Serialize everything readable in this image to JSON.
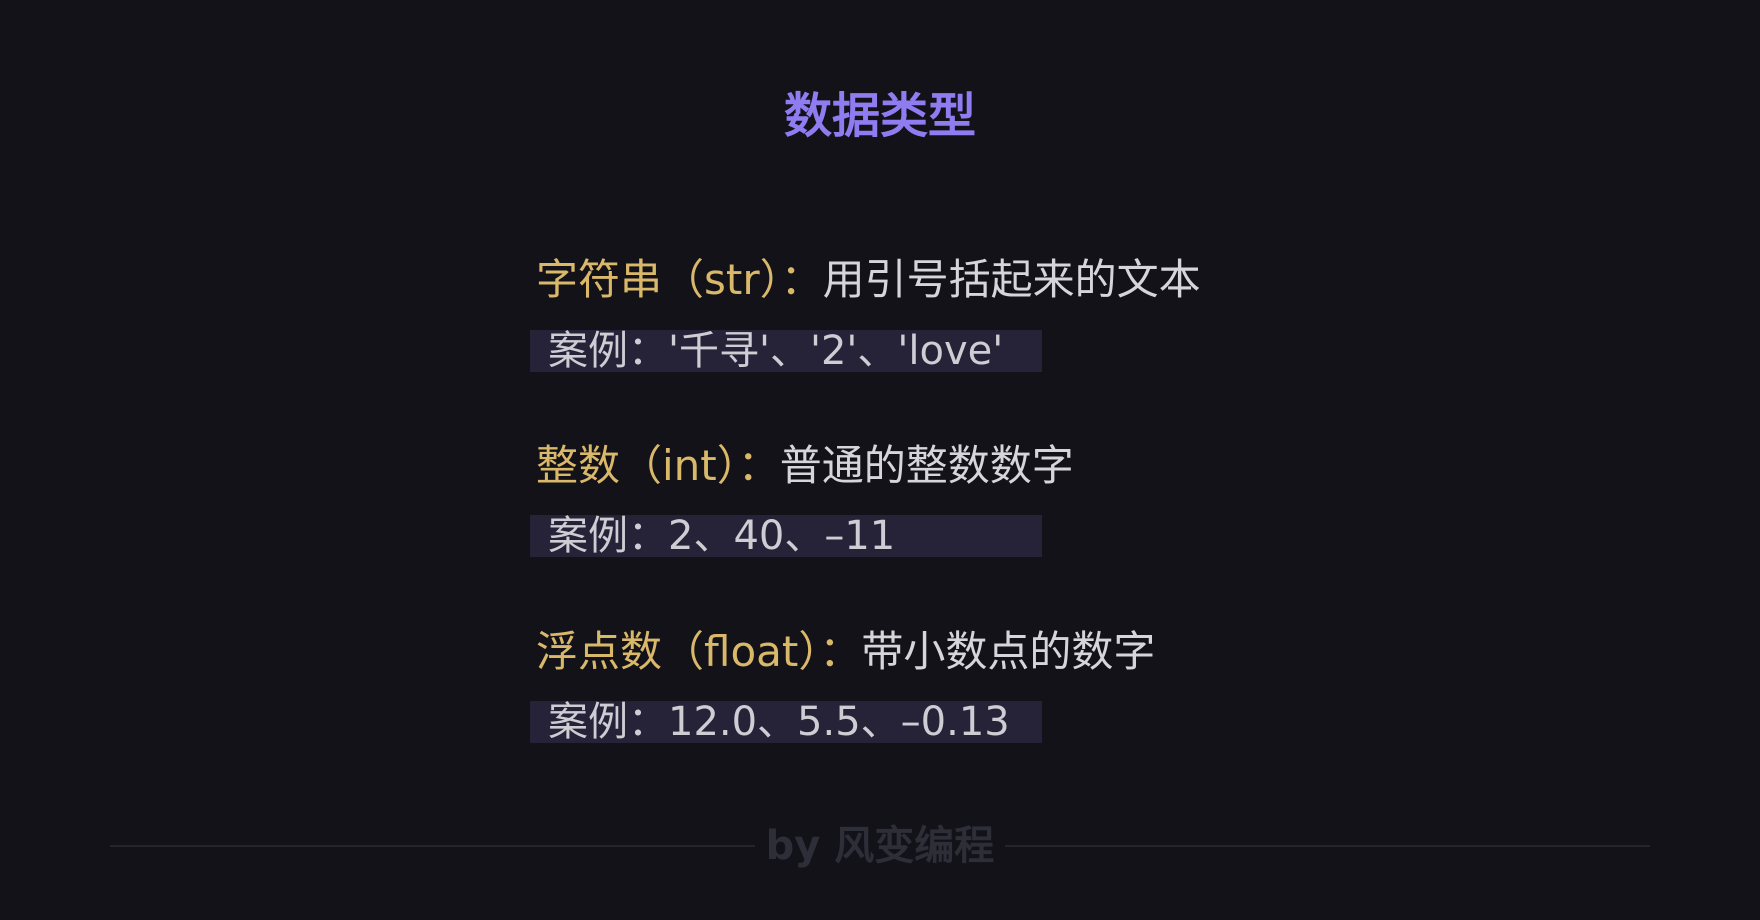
{
  "title": "数据类型",
  "items": [
    {
      "term": "字符串（str）：",
      "description": "用引号括起来的文本",
      "example": "案例：'千寻'、'2'、'love'"
    },
    {
      "term": "整数（int）：",
      "description": "普通的整数数字",
      "example": "案例：2、40、–11"
    },
    {
      "term": "浮点数（float）：",
      "description": "带小数点的数字",
      "example": "案例：12.0、5.5、–0.13"
    }
  ],
  "footer": {
    "text": "by 风变编程"
  },
  "colors": {
    "background": "#121218",
    "title": "#8f7cf0",
    "term": "#d9b86a",
    "description": "#d6d6da",
    "example_background": "#262238",
    "example_text": "#cdcdd3",
    "footer": "#2e2e38"
  }
}
